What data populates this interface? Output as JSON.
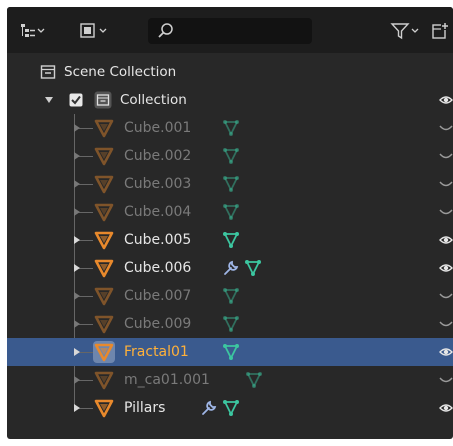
{
  "header": {
    "display_mode_icon": "outliner-display-icon",
    "filter_icon": "filter-icon",
    "new_collection_icon": "new-collection-icon",
    "search": {
      "value": "",
      "placeholder": ""
    }
  },
  "scene_collection": {
    "label": "Scene Collection"
  },
  "collection": {
    "label": "Collection",
    "checked": true
  },
  "items": [
    {
      "label": "Cube.001",
      "dim": true,
      "modifier": false,
      "selected": false
    },
    {
      "label": "Cube.002",
      "dim": true,
      "modifier": false,
      "selected": false
    },
    {
      "label": "Cube.003",
      "dim": true,
      "modifier": false,
      "selected": false
    },
    {
      "label": "Cube.004",
      "dim": true,
      "modifier": false,
      "selected": false
    },
    {
      "label": "Cube.005",
      "dim": false,
      "modifier": false,
      "selected": false
    },
    {
      "label": "Cube.006",
      "dim": false,
      "modifier": true,
      "selected": false
    },
    {
      "label": "Cube.007",
      "dim": true,
      "modifier": false,
      "selected": false
    },
    {
      "label": "Cube.009",
      "dim": true,
      "modifier": false,
      "selected": false
    },
    {
      "label": "Fractal01",
      "dim": false,
      "modifier": false,
      "selected": true
    },
    {
      "label": "m_ca01.001",
      "dim": true,
      "modifier": false,
      "selected": false
    },
    {
      "label": "Pillars",
      "dim": false,
      "modifier": true,
      "selected": false
    }
  ],
  "colors": {
    "mesh_data": "#3cc6a0",
    "object": "#e8892c",
    "selected_text": "#ffb13a",
    "selection_bg": "#3a5a8e"
  }
}
